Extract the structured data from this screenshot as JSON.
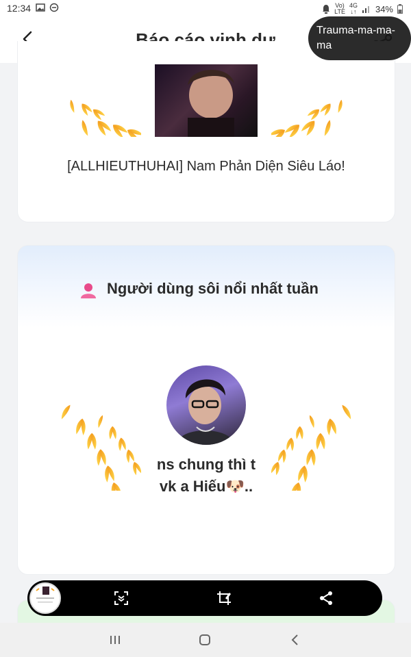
{
  "status_bar": {
    "time": "12:34",
    "network_top": "Vo)",
    "network_bottom": "LTE",
    "net4g_top": "4G",
    "net4g_bottom": "↓↑",
    "battery": "34%",
    "icons": [
      "gallery-icon",
      "dnd-icon",
      "alarm-icon",
      "signal-icon",
      "battery-icon"
    ]
  },
  "header": {
    "title": "Báo cáo vinh dự",
    "back_icon": "chevron-left-icon",
    "share_icon": "share-icon"
  },
  "bubble": {
    "text": "Trauma-ma-ma-ma"
  },
  "card_story": {
    "name": "[ALLHIEUTHUHAI] Nam Phản Diện Siêu Láo!"
  },
  "card_user": {
    "section_title": "Người dùng sôi nổi nhất tuần",
    "section_icon": "user-icon",
    "username_line1": "ns chung thì t",
    "username_line2": "vk a Hiếu🐶.."
  },
  "toolbar": {
    "buttons": [
      "scan-icon",
      "crop-icon",
      "share-icon"
    ]
  },
  "colors": {
    "accent_gold": "#f6a623",
    "accent_pink": "#e84a8a",
    "toolbar_bg": "#000000"
  }
}
